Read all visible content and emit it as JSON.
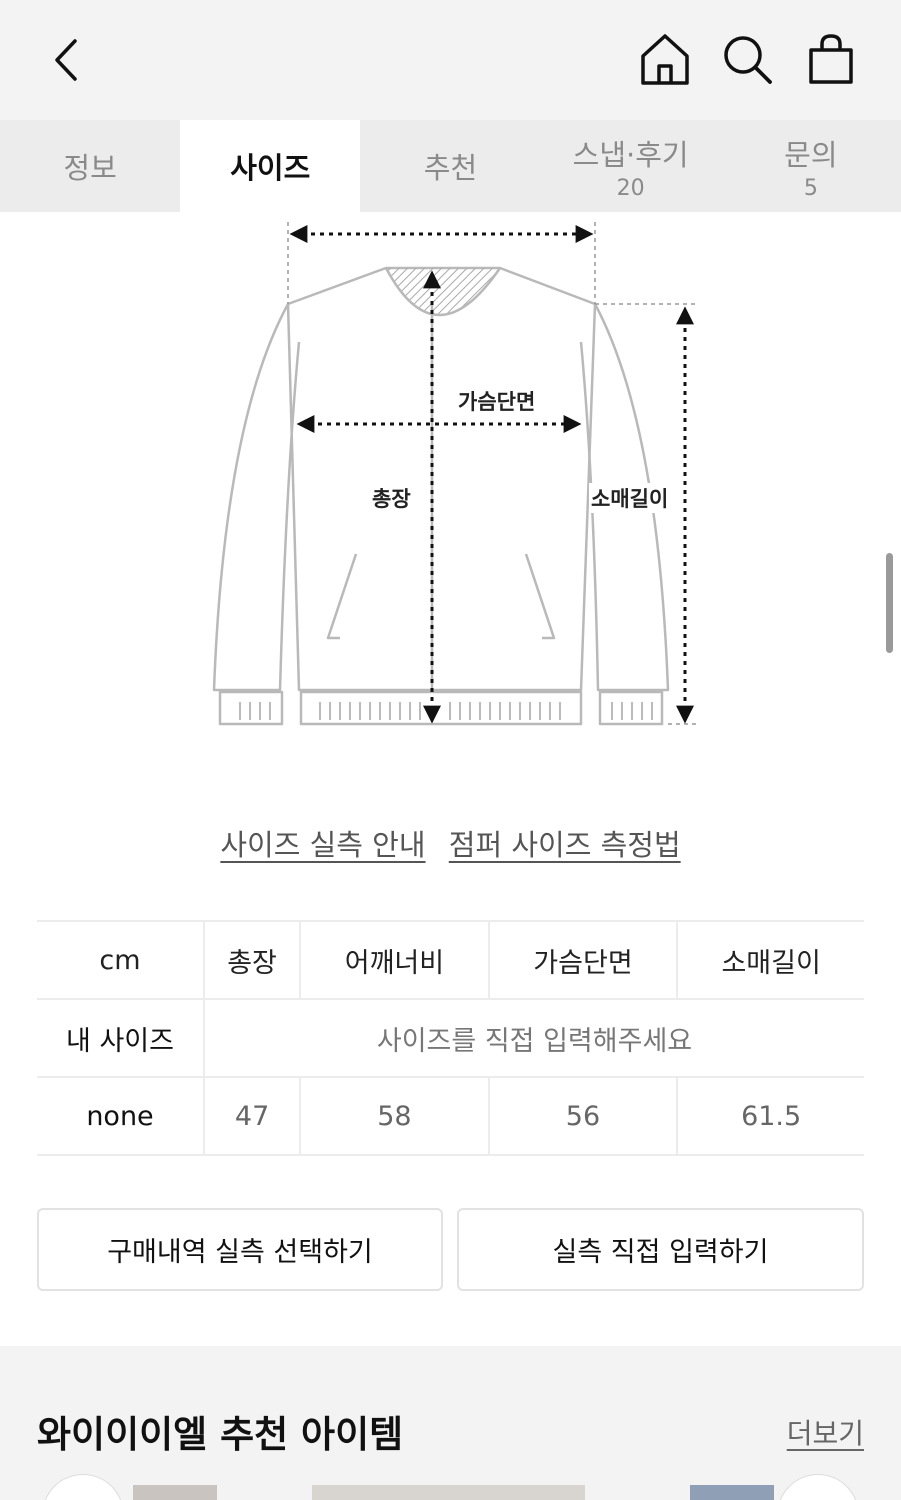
{
  "header": {
    "back_icon": "chevron-left-icon",
    "home_icon": "home-icon",
    "search_icon": "search-icon",
    "bag_icon": "shopping-bag-icon"
  },
  "tabs": [
    {
      "label": "정보",
      "count": "",
      "active": false
    },
    {
      "label": "사이즈",
      "count": "",
      "active": true
    },
    {
      "label": "추천",
      "count": "",
      "active": false
    },
    {
      "label": "스냅·후기",
      "count": "20",
      "active": false
    },
    {
      "label": "문의",
      "count": "5",
      "active": false
    }
  ],
  "diagram": {
    "chest_label": "가슴단면",
    "length_label": "총장",
    "sleeve_label": "소매길이"
  },
  "guide_links": {
    "size_guide": "사이즈 실측 안내",
    "jumper_measure": "점퍼 사이즈 측정법"
  },
  "size_table": {
    "unit": "cm",
    "columns": [
      "총장",
      "어깨너비",
      "가슴단면",
      "소매길이"
    ],
    "my_size_label": "내 사이즈",
    "my_size_placeholder": "사이즈를 직접 입력해주세요",
    "rows": [
      {
        "name": "none",
        "values": [
          "47",
          "58",
          "56",
          "61.5"
        ]
      }
    ]
  },
  "buttons": {
    "purchase_history": "구매내역 실측 선택하기",
    "direct_input": "실측 직접 입력하기"
  },
  "recommend": {
    "title": "와이이이엘 추천 아이템",
    "more": "더보기"
  },
  "colors": {
    "header_bg": "#f3f3f3",
    "tab_bg": "#ececec",
    "active_tab_bg": "#ffffff"
  }
}
